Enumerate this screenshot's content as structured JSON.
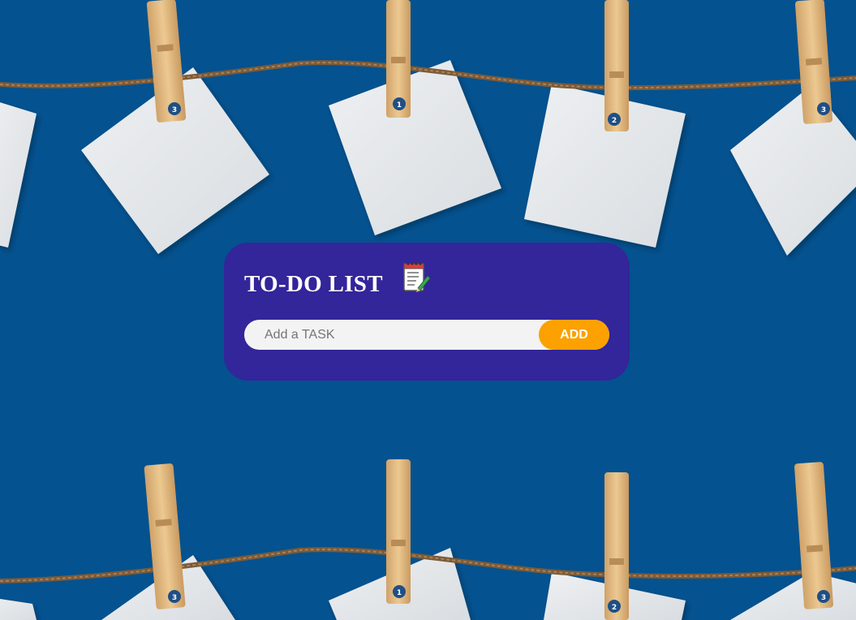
{
  "app": {
    "title": "TO-DO LIST",
    "title_icon": "notepad-checklist-icon"
  },
  "task_form": {
    "input_placeholder": "Add a TASK",
    "input_value": "",
    "add_label": "ADD"
  },
  "background": {
    "color": "#04528f",
    "theme": "clothesline-notes",
    "pin_numbers_top": [
      "3",
      "1",
      "2",
      "3"
    ],
    "pin_numbers_bottom": [
      "3",
      "1",
      "2",
      "3"
    ]
  },
  "colors": {
    "card": "#33259a",
    "add_button": "#fca100",
    "input_bg": "#f3f3f3",
    "paper": "#e6e8ea",
    "pin_wood": "#e4c08a",
    "twine": "#7c5a38"
  }
}
